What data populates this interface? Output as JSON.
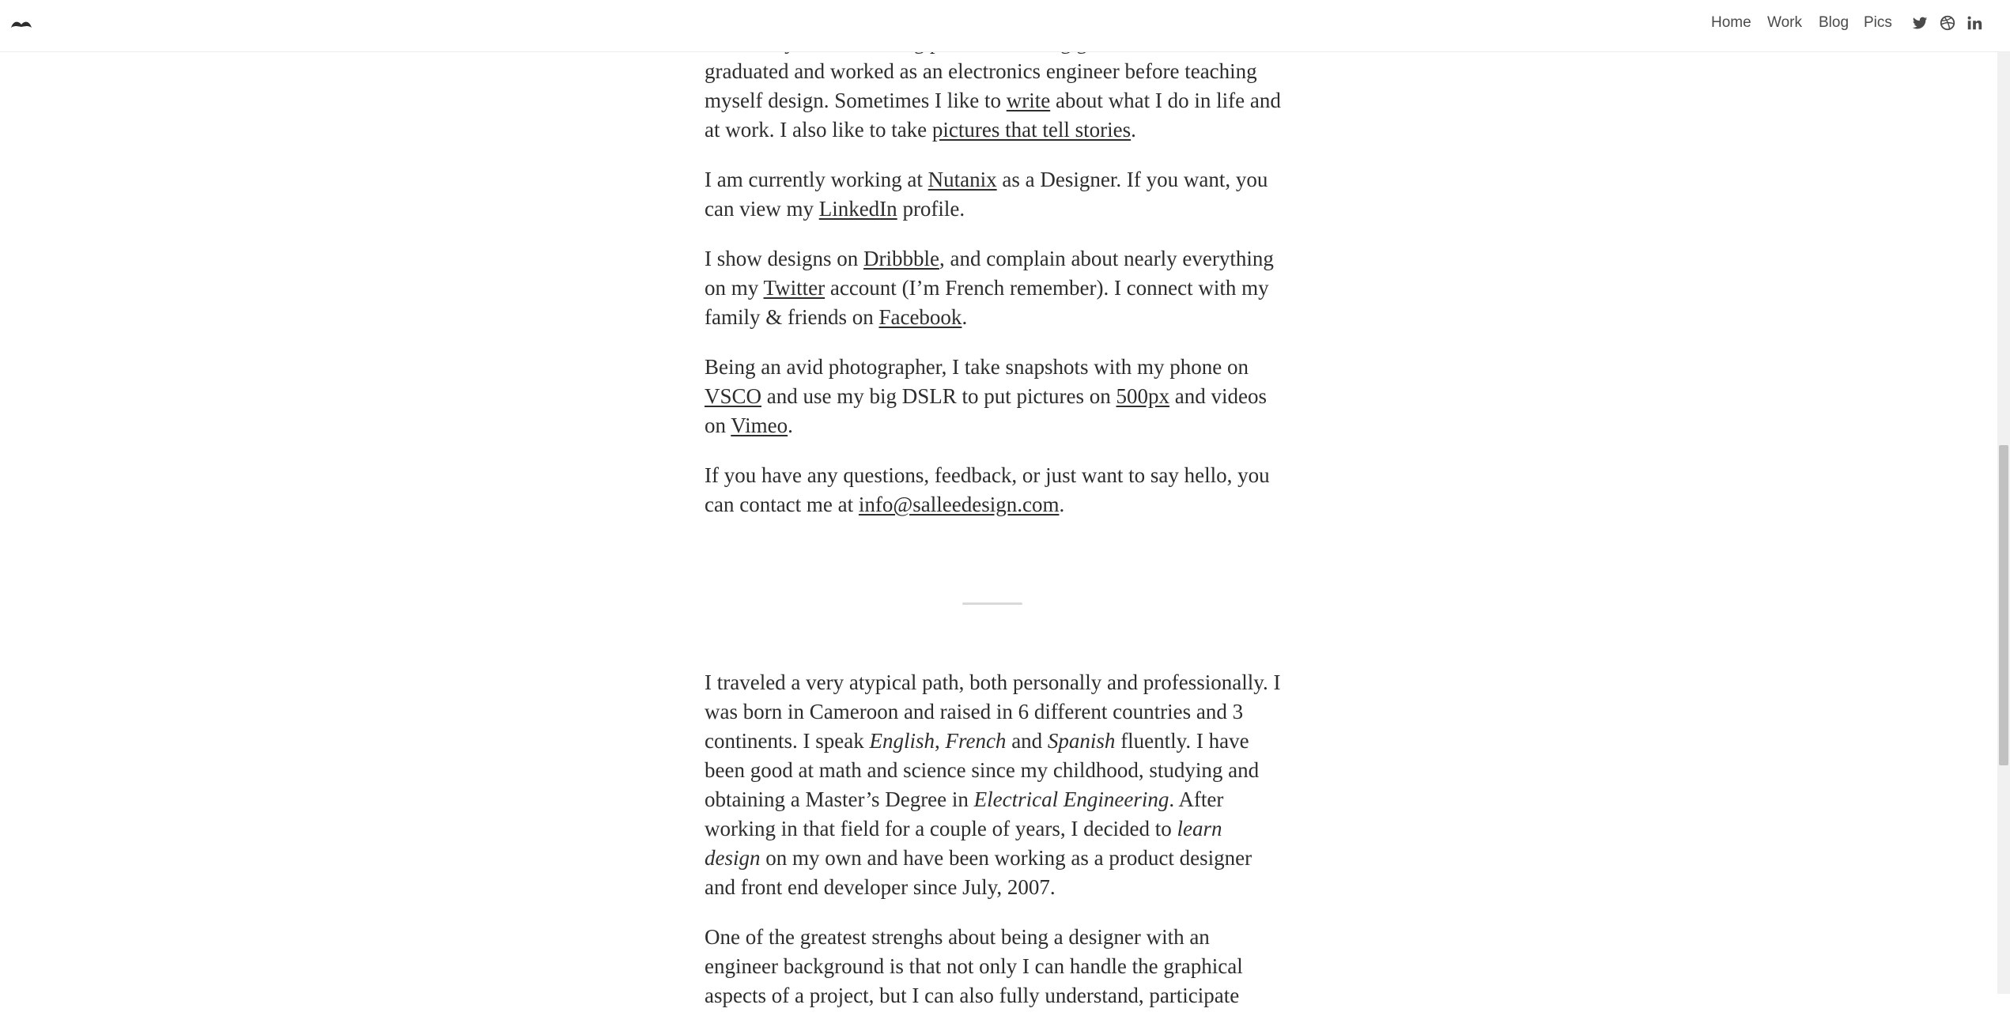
{
  "nav": {
    "logo_icon": "mustache-icon",
    "links": [
      "Home",
      "Work",
      "Blog",
      "Pics"
    ],
    "social_icons": [
      "twitter-icon",
      "dribbble-icon",
      "linkedin-icon"
    ]
  },
  "p1": {
    "t1": "I’ve always loved solving problems. Being good at science, I graduated and worked as an electronics engineer before teaching myself design. Sometimes I like to ",
    "link1": "write",
    "t2": " about what I do in life and at work. I also like to take ",
    "link2": "pictures that tell stories",
    "t3": "."
  },
  "p2": {
    "t1": "I am currently working at ",
    "link1": "Nutanix",
    "t2": " as a Designer. If you want, you can view my ",
    "link2": "LinkedIn",
    "t3": " profile."
  },
  "p3": {
    "t1": "I show designs on ",
    "link1": "Dribbble",
    "t2": ", and complain about nearly everything on my ",
    "link2": "Twitter",
    "t3": " account (I’m French remember). I connect with my family & friends on ",
    "link3": "Facebook",
    "t4": "."
  },
  "p4": {
    "t1": "Being an avid photographer, I take snapshots with my phone on ",
    "link1": "VSCO",
    "t2": " and use my big DSLR to put pictures on ",
    "link2": "500px",
    "t3": " and videos on ",
    "link3": "Vimeo",
    "t4": "."
  },
  "p5": {
    "t1": "If you have any questions, feedback, or just want to say hello, you can contact me at ",
    "link1": "info@salleedesign.com",
    "t2": "."
  },
  "p6": {
    "t1": "I traveled a very atypical path, both personally and professionally. I was born in Cameroon and raised in 6 different countries and 3 continents. I speak ",
    "em1": "English",
    "t2": ", ",
    "em2": "French",
    "t3": " and ",
    "em3": "Spanish",
    "t4": " fluently. I have been good at math and science since my childhood, studying and obtaining a Master’s Degree in ",
    "em4": "Electrical Engineering",
    "t5": ". After working in that field for a couple of years, I decided to ",
    "em5": "learn design",
    "t6": " on my own and have been working as a product designer and front end developer since July, 2007."
  },
  "p7": {
    "t1": "One of the greatest strenghs about being a designer with an engineer background is that not only I can handle the graphical aspects of a project, but I can also fully understand, participate"
  },
  "colors": {
    "text": "#2d2d2d",
    "nav_text": "#4a4a4a",
    "divider": "#d9d9d9",
    "background": "#ffffff"
  }
}
